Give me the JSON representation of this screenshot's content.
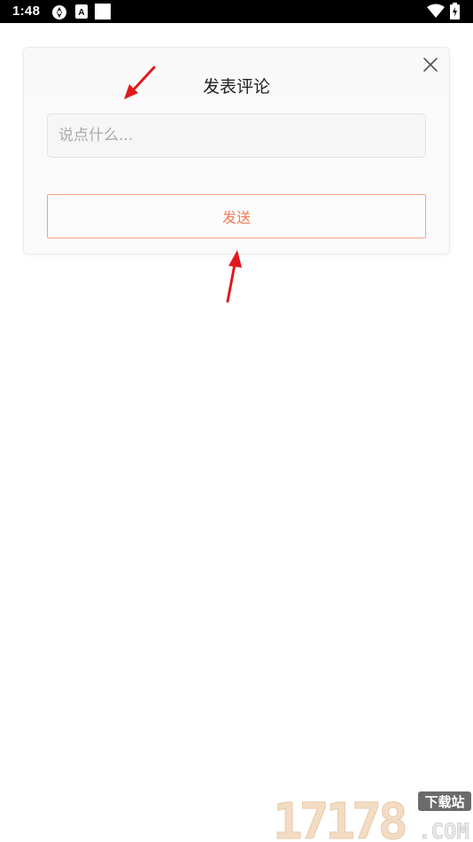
{
  "status_bar": {
    "time": "1:48",
    "icons": [
      "settings-sync-icon",
      "a-box-icon",
      "white-square-icon",
      "wifi-icon",
      "battery-icon"
    ]
  },
  "dialog": {
    "title": "发表评论",
    "input_placeholder": "说点什么...",
    "input_value": "",
    "send_label": "发送",
    "close_icon": "close-icon"
  },
  "annotations": {
    "arrow_color": "#e0191e"
  },
  "watermark": {
    "number": "17178",
    "tag": "下载站",
    "domain": ".COM"
  },
  "colors": {
    "accent": "#f07a55",
    "accent_border": "#f5a189",
    "background": "#ffffff",
    "dialog_bg": "#fafafa"
  }
}
